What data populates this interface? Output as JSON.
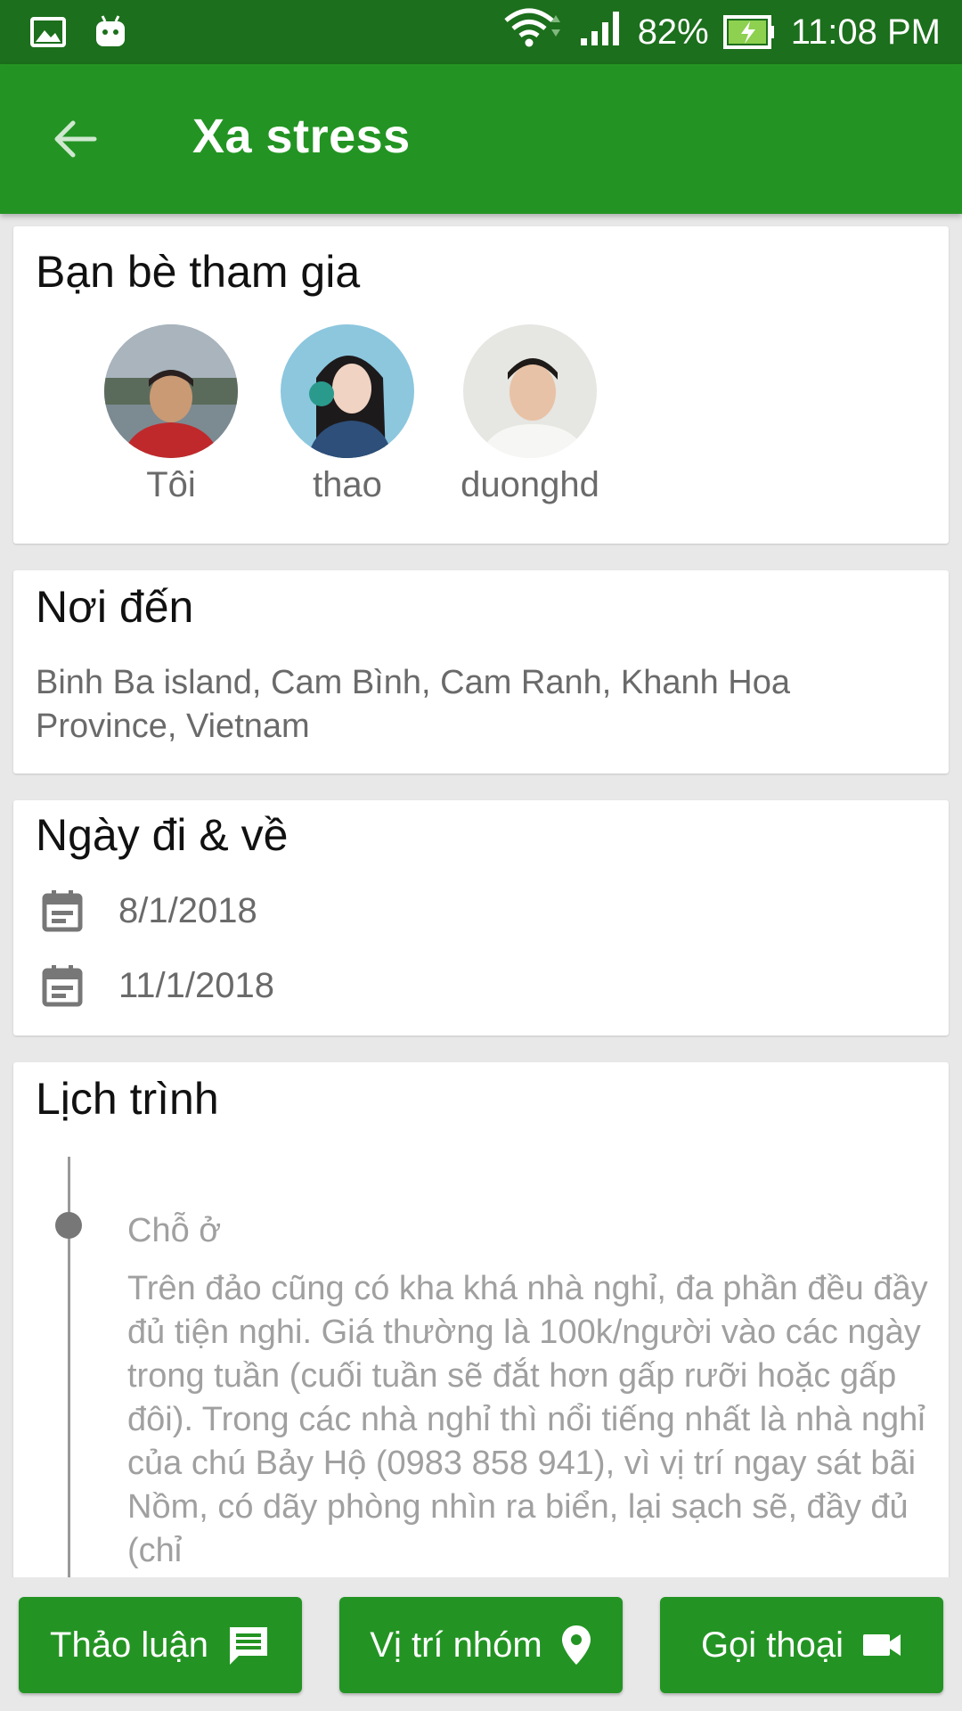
{
  "status_bar": {
    "battery_percent": "82%",
    "time": "11:08 PM",
    "icons": [
      "photo-icon",
      "android-icon",
      "wifi-icon",
      "signal-icon",
      "battery-charging-icon"
    ]
  },
  "app_bar": {
    "back_icon": "arrow-back-icon",
    "title": "Xa stress"
  },
  "friends_card": {
    "title": "Bạn bè tham gia",
    "friends": [
      {
        "name": "Tôi"
      },
      {
        "name": "thao"
      },
      {
        "name": "duonghd"
      }
    ]
  },
  "destination_card": {
    "title": "Nơi đến",
    "address": "Binh Ba island, Cam Bình, Cam Ranh, Khanh Hoa Province, Vietnam"
  },
  "dates_card": {
    "title": "Ngày đi & về",
    "start_date": "8/1/2018",
    "end_date": "11/1/2018",
    "icon": "calendar-icon"
  },
  "schedule_card": {
    "title": "Lịch trình",
    "items": [
      {
        "subtitle": "Chỗ ở",
        "text": "Trên đảo cũng có kha khá nhà nghỉ, đa phần đều đầy đủ tiện nghi. Giá thường là 100k/người vào các ngày trong tuần (cuối tuần sẽ đắt hơn gấp rưỡi hoặc gấp đôi). Trong các nhà nghỉ thì nổi tiếng nhất là nhà nghỉ của chú Bảy Hộ (0983 858 941), vì vị trí ngay sát bãi Nồm, có dãy phòng nhìn ra biển, lại sạch sẽ, đầy đủ (chỉ"
      }
    ]
  },
  "bottom_buttons": {
    "discuss": {
      "label": "Thảo luận",
      "icon": "chat-icon"
    },
    "location": {
      "label": "Vị trí nhóm",
      "icon": "location-pin-icon"
    },
    "call": {
      "label": "Gọi thoại",
      "icon": "videocam-icon"
    }
  },
  "colors": {
    "status_bar": "#1c6f1c",
    "primary": "#239423",
    "background": "#e8e8e8"
  }
}
